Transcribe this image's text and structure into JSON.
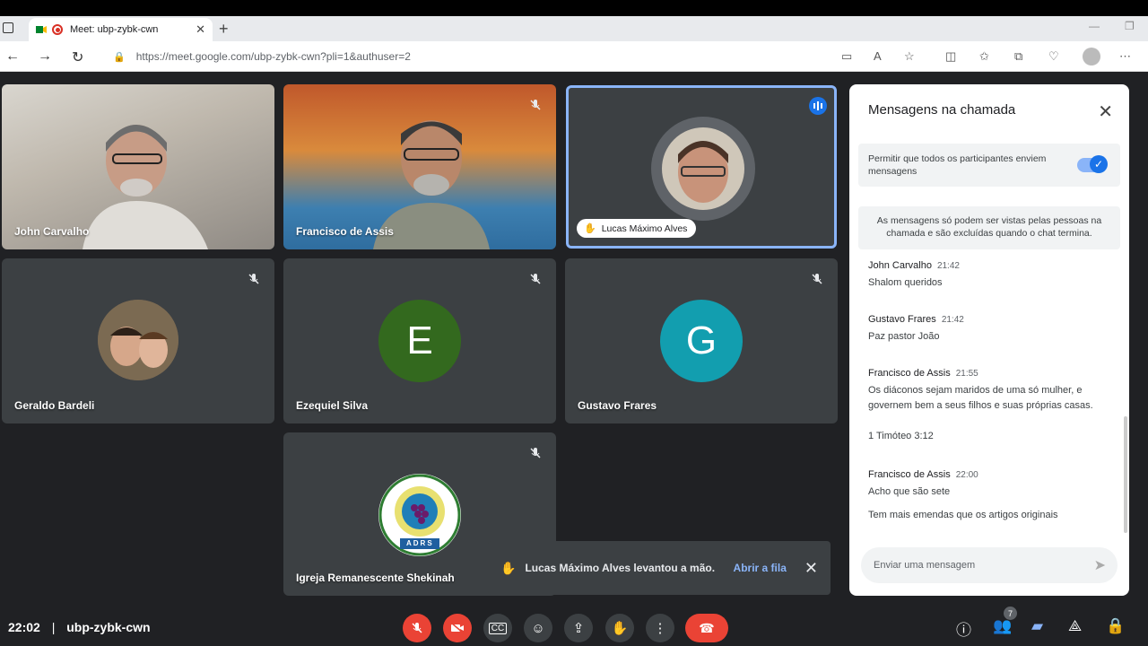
{
  "browser": {
    "tab_title": "Meet: ubp-zybk-cwn",
    "url": "https://meet.google.com/ubp-zybk-cwn?pli=1&authuser=2"
  },
  "participants": [
    {
      "name": "John Carvalho",
      "muted": false
    },
    {
      "name": "Francisco de Assis",
      "muted": true
    },
    {
      "name": "Lucas Máximo Alves",
      "muted": false,
      "speaking": true,
      "hand_raised": true
    },
    {
      "name": "Geraldo Bardeli",
      "muted": true
    },
    {
      "name": "Ezequiel Silva",
      "muted": true,
      "initial": "E",
      "color": "#33691e"
    },
    {
      "name": "Gustavo Frares",
      "muted": true,
      "initial": "G",
      "color": "#129eaf"
    },
    {
      "name": "Igreja Remanescente Shekinah",
      "muted": true,
      "logo_text": "ADRS"
    }
  ],
  "chat": {
    "title": "Mensagens na chamada",
    "permission_text": "Permitir que todos os participantes enviem mensagens",
    "permission_enabled": true,
    "info_text": "As mensagens só podem ser vistas pelas pessoas na chamada e são excluídas quando o chat termina.",
    "messages": [
      {
        "sender": "John Carvalho",
        "time": "21:42",
        "lines": [
          "Shalom queridos"
        ]
      },
      {
        "sender": "Gustavo Frares",
        "time": "21:42",
        "lines": [
          "Paz pastor João"
        ]
      },
      {
        "sender": "Francisco de Assis",
        "time": "21:55",
        "lines": [
          "Os diáconos sejam maridos de uma só mulher, e governem bem a seus filhos e suas próprias casas.",
          "1 Timóteo 3:12"
        ]
      },
      {
        "sender": "Francisco de Assis",
        "time": "22:00",
        "lines": [
          "Acho que são sete",
          "Tem mais emendas que os artigos originais"
        ]
      }
    ],
    "input_placeholder": "Enviar uma mensagem"
  },
  "toast": {
    "message": "Lucas Máximo Alves levantou a mão.",
    "action": "Abrir a fila"
  },
  "bottom_bar": {
    "time": "22:02",
    "separator": "|",
    "meeting_code": "ubp-zybk-cwn",
    "participant_count": "7"
  },
  "colors": {
    "accent": "#1a73e8",
    "danger": "#ea4335",
    "tile_bg": "#3c4043",
    "page_bg": "#202124"
  }
}
